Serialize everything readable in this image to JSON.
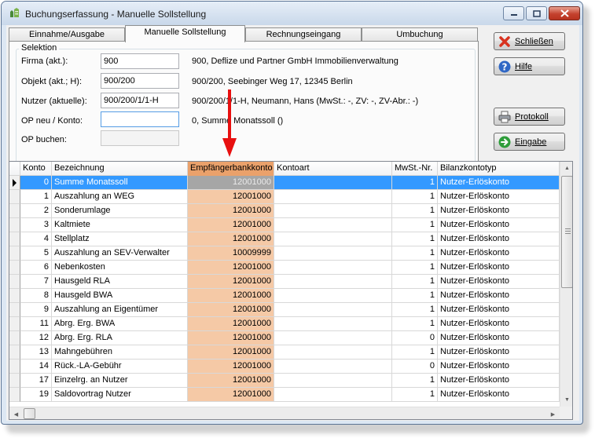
{
  "window": {
    "title": "Buchungserfassung - Manuelle Sollstellung"
  },
  "tabs": [
    {
      "label": "Einnahme/Ausgabe",
      "active": false
    },
    {
      "label": "Manuelle Sollstellung",
      "active": true
    },
    {
      "label": "Rechnungseingang",
      "active": false
    },
    {
      "label": "Umbuchung",
      "active": false
    }
  ],
  "selection": {
    "legend": "Selektion",
    "fields": [
      {
        "label": "Firma (akt.):",
        "value": "900",
        "description": "900,  Deflize und Partner GmbH Immobilienverwaltung",
        "state": "normal"
      },
      {
        "label": "Objekt (akt.; H):",
        "value": "900/200",
        "description": "900/200,  Seebinger Weg 17, 12345 Berlin",
        "state": "normal"
      },
      {
        "label": "Nutzer (aktuelle):",
        "value": "900/200/1/1-H",
        "description": "900/200/1/1-H,  Neumann, Hans  (MwSt.: -,  ZV: -, ZV-Abr.: -)",
        "state": "normal"
      },
      {
        "label": "OP neu / Konto:",
        "value": "",
        "description": "0,  Summe Monatssoll  ()",
        "state": "focused"
      },
      {
        "label": "OP buchen:",
        "value": "",
        "description": "",
        "state": "disabled"
      }
    ]
  },
  "buttons": [
    {
      "label": "Schließen",
      "icon": "close-x-icon"
    },
    {
      "label": "Hilfe",
      "icon": "help-icon"
    },
    {
      "label": "Protokoll",
      "icon": "printer-icon"
    },
    {
      "label": "Eingabe",
      "icon": "arrow-right-icon"
    }
  ],
  "grid": {
    "columns": [
      "Konto",
      "Bezeichnung",
      "Empfängerbankkonto",
      "Kontoart",
      "MwSt.-Nr.",
      "Bilanzkontotyp"
    ],
    "sorted_column": "Empfängerbankkonto",
    "selected_row": 0,
    "rows": [
      [
        "0",
        "Summe Monatssoll",
        "12001000",
        "",
        "1",
        "Nutzer-Erlöskonto"
      ],
      [
        "1",
        "Auszahlung an WEG",
        "12001000",
        "",
        "1",
        "Nutzer-Erlöskonto"
      ],
      [
        "2",
        "Sonderumlage",
        "12001000",
        "",
        "1",
        "Nutzer-Erlöskonto"
      ],
      [
        "3",
        "Kaltmiete",
        "12001000",
        "",
        "1",
        "Nutzer-Erlöskonto"
      ],
      [
        "4",
        "Stellplatz",
        "12001000",
        "",
        "1",
        "Nutzer-Erlöskonto"
      ],
      [
        "5",
        "Auszahlung an SEV-Verwalter",
        "10009999",
        "",
        "1",
        "Nutzer-Erlöskonto"
      ],
      [
        "6",
        "Nebenkosten",
        "12001000",
        "",
        "1",
        "Nutzer-Erlöskonto"
      ],
      [
        "7",
        "Hausgeld RLA",
        "12001000",
        "",
        "1",
        "Nutzer-Erlöskonto"
      ],
      [
        "8",
        "Hausgeld BWA",
        "12001000",
        "",
        "1",
        "Nutzer-Erlöskonto"
      ],
      [
        "9",
        "Auszahlung an Eigentümer",
        "12001000",
        "",
        "1",
        "Nutzer-Erlöskonto"
      ],
      [
        "11",
        "Abrg. Erg. BWA",
        "12001000",
        "",
        "1",
        "Nutzer-Erlöskonto"
      ],
      [
        "12",
        "Abrg. Erg. RLA",
        "12001000",
        "",
        "0",
        "Nutzer-Erlöskonto"
      ],
      [
        "13",
        "Mahngebühren",
        "12001000",
        "",
        "1",
        "Nutzer-Erlöskonto"
      ],
      [
        "14",
        "Rück.-LA-Gebühr",
        "12001000",
        "",
        "0",
        "Nutzer-Erlöskonto"
      ],
      [
        "17",
        "Einzelrg. an Nutzer",
        "12001000",
        "",
        "1",
        "Nutzer-Erlöskonto"
      ],
      [
        "19",
        "Saldovortrag Nutzer",
        "12001000",
        "",
        "1",
        "Nutzer-Erlöskonto"
      ]
    ]
  },
  "colors": {
    "selected_row": "#3399ff",
    "highlight_column": "#f5c9a6",
    "highlight_header": "#eaa16b",
    "annotation_arrow": "#e81010"
  }
}
